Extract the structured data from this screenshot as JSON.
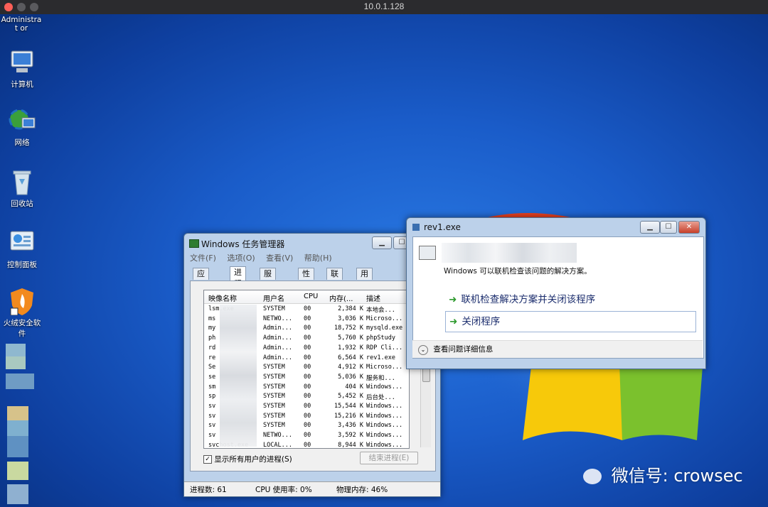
{
  "mac": {
    "title": "10.0.1.128"
  },
  "desktop": {
    "icons": [
      {
        "label": "Administrat or"
      },
      {
        "label": "计算机"
      },
      {
        "label": "网络"
      },
      {
        "label": "回收站"
      },
      {
        "label": "控制面板"
      },
      {
        "label": "火绒安全软件"
      }
    ]
  },
  "task_manager": {
    "title": "Windows 任务管理器",
    "menu": [
      "文件(F)",
      "选项(O)",
      "查看(V)",
      "帮助(H)"
    ],
    "tabs": [
      "应用程序",
      "进程",
      "服务",
      "性能",
      "联网",
      "用户"
    ],
    "active_tab": "进程",
    "columns": [
      "映像名称",
      "用户名",
      "CPU",
      "内存(...",
      "描述"
    ],
    "rows": [
      [
        "lsm.exe",
        "SYSTEM",
        "00",
        "2,384 K",
        "本地会..."
      ],
      [
        "ms",
        "NETWO...",
        "00",
        "3,036 K",
        "Microso..."
      ],
      [
        "my",
        "Admin...",
        "00",
        "18,752 K",
        "mysqld.exe"
      ],
      [
        "ph",
        "Admin...",
        "00",
        "5,760 K",
        "phpStudy"
      ],
      [
        "rd",
        "Admin...",
        "00",
        "1,932 K",
        "RDP Cli..."
      ],
      [
        "re",
        "Admin...",
        "00",
        "6,564 K",
        "rev1.exe"
      ],
      [
        "Se",
        "SYSTEM",
        "00",
        "4,912 K",
        "Microso..."
      ],
      [
        "se",
        "SYSTEM",
        "00",
        "5,036 K",
        "服务和..."
      ],
      [
        "sm",
        "SYSTEM",
        "00",
        "404 K",
        "Windows..."
      ],
      [
        "sp",
        "SYSTEM",
        "00",
        "5,452 K",
        "后台处..."
      ],
      [
        "sv",
        "SYSTEM",
        "00",
        "15,544 K",
        "Windows..."
      ],
      [
        "sv",
        "SYSTEM",
        "00",
        "15,216 K",
        "Windows..."
      ],
      [
        "sv",
        "SYSTEM",
        "00",
        "3,436 K",
        "Windows..."
      ],
      [
        "sv",
        "NETWO...",
        "00",
        "3,592 K",
        "Windows..."
      ],
      [
        "svchost.exe",
        "LOCAL...",
        "00",
        "8,944 K",
        "Windows..."
      ]
    ],
    "show_all_label": "显示所有用户的进程(S)",
    "end_process_label": "结束进程(E)",
    "status": {
      "processes": "进程数: 61",
      "cpu": "CPU 使用率: 0%",
      "memory": "物理内存: 46%"
    }
  },
  "dialog": {
    "title": "rev1.exe",
    "message": "Windows 可以联机检查该问题的解决方案。",
    "option1": "联机检查解决方案并关闭该程序",
    "option2": "关闭程序",
    "details": "查看问题详细信息"
  },
  "watermark": "微信号: crowsec",
  "colors": {
    "desktop": "#1a5cc9",
    "window_frame": "#bcd1ea",
    "link": "#1c2e6e",
    "arrow": "#2e9a2e"
  }
}
